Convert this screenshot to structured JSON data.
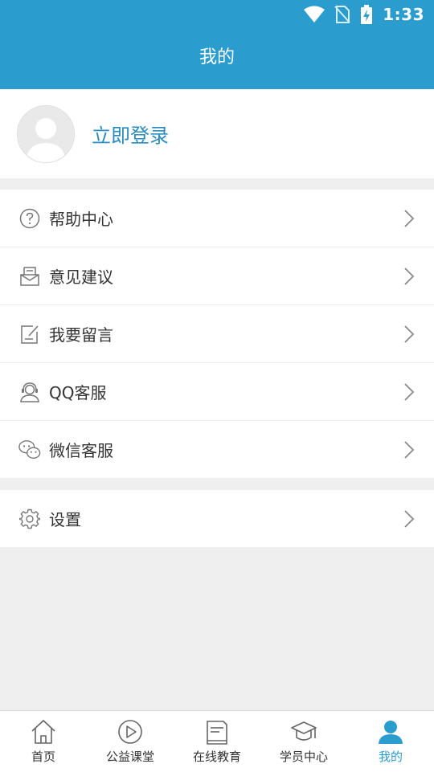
{
  "status_bar": {
    "time": "1:33"
  },
  "header": {
    "title": "我的"
  },
  "profile": {
    "login_text": "立即登录"
  },
  "menu_groups": [
    [
      {
        "icon": "help-icon",
        "label": "帮助中心"
      },
      {
        "icon": "feedback-icon",
        "label": "意见建议"
      },
      {
        "icon": "edit-note-icon",
        "label": "我要留言"
      },
      {
        "icon": "headset-support-icon",
        "label": "QQ客服"
      },
      {
        "icon": "wechat-icon",
        "label": "微信客服"
      }
    ],
    [
      {
        "icon": "gear-icon",
        "label": "设置"
      }
    ]
  ],
  "tabbar": {
    "tabs": [
      {
        "icon": "home-icon",
        "label": "首页"
      },
      {
        "icon": "play-circle-icon",
        "label": "公益课堂"
      },
      {
        "icon": "book-icon",
        "label": "在线教育"
      },
      {
        "icon": "graduation-cap-icon",
        "label": "学员中心"
      },
      {
        "icon": "person-icon",
        "label": "我的"
      }
    ],
    "active_index": 4
  },
  "colors": {
    "accent": "#2a9ccd",
    "link": "#2a8bbf",
    "background": "#efefef"
  }
}
